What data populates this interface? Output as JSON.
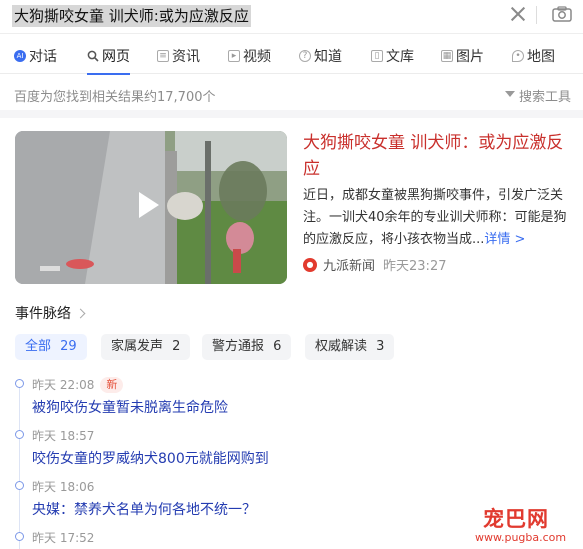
{
  "search": {
    "query": "大狗撕咬女童 训犬师:或为应激反应"
  },
  "tabs": [
    {
      "label": "对话",
      "icon": "ai-chat-icon"
    },
    {
      "label": "网页",
      "icon": "search-icon"
    },
    {
      "label": "资讯",
      "icon": "news-icon"
    },
    {
      "label": "视频",
      "icon": "video-icon"
    },
    {
      "label": "知道",
      "icon": "question-icon"
    },
    {
      "label": "文库",
      "icon": "document-icon"
    },
    {
      "label": "图片",
      "icon": "image-icon"
    },
    {
      "label": "地图",
      "icon": "map-pin-icon"
    }
  ],
  "results": {
    "stats": "百度为您找到相关结果约17,700个",
    "tools_label": "搜索工具"
  },
  "card": {
    "title": "大狗撕咬女童 训犬师：或为应激反应",
    "snippet": "近日，成都女童被黑狗撕咬事件，引发广泛关注。一训犬40余年的专业训犬师称：可能是狗的应激反应，将小孩衣物当成...",
    "more_label": "详情 >",
    "source": "九派新闻",
    "time": "昨天23:27"
  },
  "timeline": {
    "title": "事件脉络",
    "chips": [
      {
        "label": "全部",
        "count": "29"
      },
      {
        "label": "家属发声",
        "count": "2"
      },
      {
        "label": "警方通报",
        "count": "6"
      },
      {
        "label": "权威解读",
        "count": "3"
      }
    ],
    "items": [
      {
        "time": "昨天 22:08",
        "badge": "新",
        "text": "被狗咬伤女童暂未脱离生命危险"
      },
      {
        "time": "昨天 18:57",
        "badge": "",
        "text": "咬伤女童的罗威纳犬800元就能网购到"
      },
      {
        "time": "昨天 18:06",
        "badge": "",
        "text": "央媒：禁养犬名单为何各地不统一？"
      },
      {
        "time": "昨天 17:52",
        "badge": "",
        "text": ""
      }
    ]
  },
  "watermark": {
    "brand": "宠巴网",
    "url": "www.pugba.com"
  },
  "colors": {
    "accent": "#3a6df0",
    "title_red": "#c9302c",
    "link_blue": "#243cb1",
    "new_badge": "#e5533d"
  }
}
